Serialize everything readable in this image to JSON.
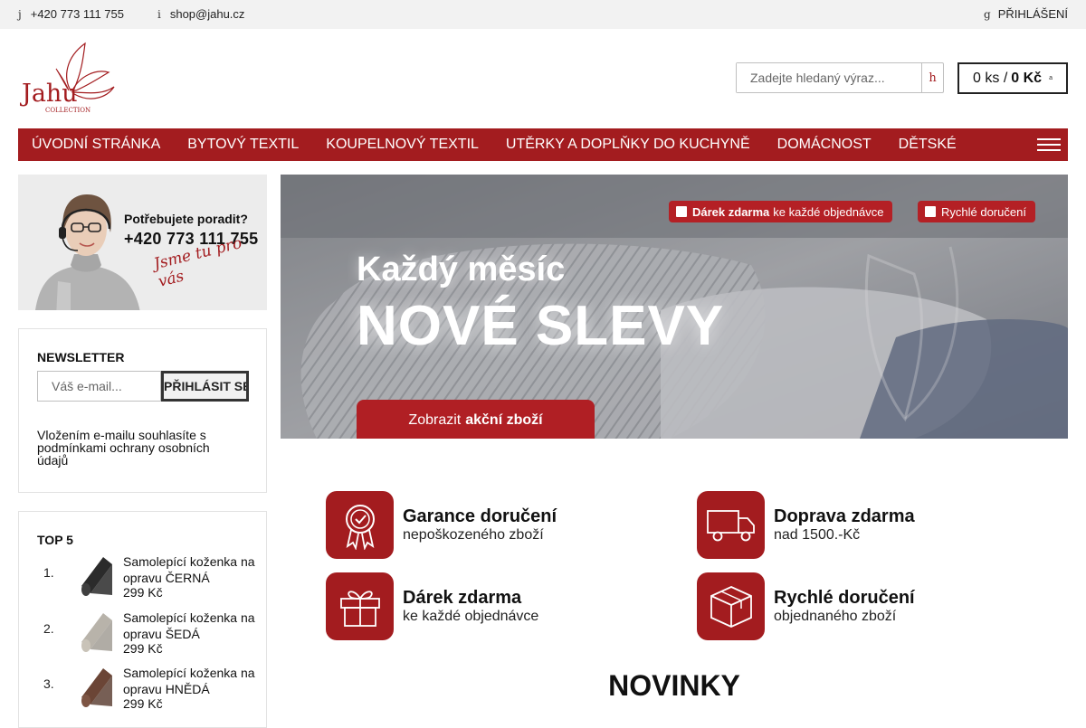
{
  "topbar": {
    "phone_glyph": "j",
    "phone": "+420 773 111 755",
    "mail_glyph": "i",
    "email": "shop@jahu.cz",
    "login_glyph": "g",
    "login": "PŘIHLÁŠENÍ"
  },
  "logo": {
    "word": "Jahu",
    "sub": "COLLECTION",
    "icon": "butterfly-logo-icon"
  },
  "search": {
    "placeholder": "Zadejte hledaný výraz...",
    "button_glyph": "h"
  },
  "cart": {
    "count": "0 ks /",
    "total": "0 Kč",
    "glyph": "a"
  },
  "nav": {
    "items": [
      "ÚVODNÍ STRÁNKA",
      "BYTOVÝ TEXTIL",
      "KOUPELNOVÝ TEXTIL",
      "UTĚRKY A DOPLŇKY DO KUCHYNĚ",
      "DOMÁCNOST",
      "DĚTSKÉ"
    ],
    "menu_icon": "hamburger-icon"
  },
  "advice": {
    "question": "Potřebujete poradit?",
    "phone": "+420  773 111 755",
    "signature": "Jsme tu pro vás"
  },
  "newsletter": {
    "title": "NEWSLETTER",
    "placeholder": "Váš e-mail...",
    "button": "PŘIHLÁSIT SE",
    "consent": "Vložením e-mailu souhlasíte s podmínkami ochrany osobních údajů"
  },
  "top5": {
    "title": "TOP 5",
    "items": [
      {
        "num": "1.",
        "name": "Samolepící koženka na opravu ČERNÁ",
        "price": "299 Kč",
        "color": "#2b2b2b"
      },
      {
        "num": "2.",
        "name": "Samolepící koženka na opravu ŠEDÁ",
        "price": "299 Kč",
        "color": "#a9a49b"
      },
      {
        "num": "3.",
        "name": "Samolepící koženka na opravu HNĚDÁ",
        "price": "299 Kč",
        "color": "#6b4536"
      }
    ]
  },
  "hero": {
    "badge1_bold": "Dárek zdarma",
    "badge1_rest": "ke každé objednávce",
    "badge2": "Rychlé doručení",
    "line1": "Každý měsíc",
    "line2": "NOVÉ SLEVY",
    "cta_pre": "Zobrazit",
    "cta_bold": "akční zboží"
  },
  "features": [
    {
      "title": "Garance doručení",
      "sub": "nepoškozeného zboží",
      "icon": "certificate-icon"
    },
    {
      "title": "Doprava zdarma",
      "sub": "nad 1500.-Kč",
      "icon": "truck-icon"
    },
    {
      "title": "Dárek zdarma",
      "sub": "ke každé objednávce",
      "icon": "gift-icon"
    },
    {
      "title": "Rychlé doručení",
      "sub": "objednaného zboží",
      "icon": "box-icon"
    }
  ],
  "section_title": "NOVINKY",
  "colors": {
    "brand": "#a31c1f",
    "topbar_bg": "#f2f2f2"
  }
}
